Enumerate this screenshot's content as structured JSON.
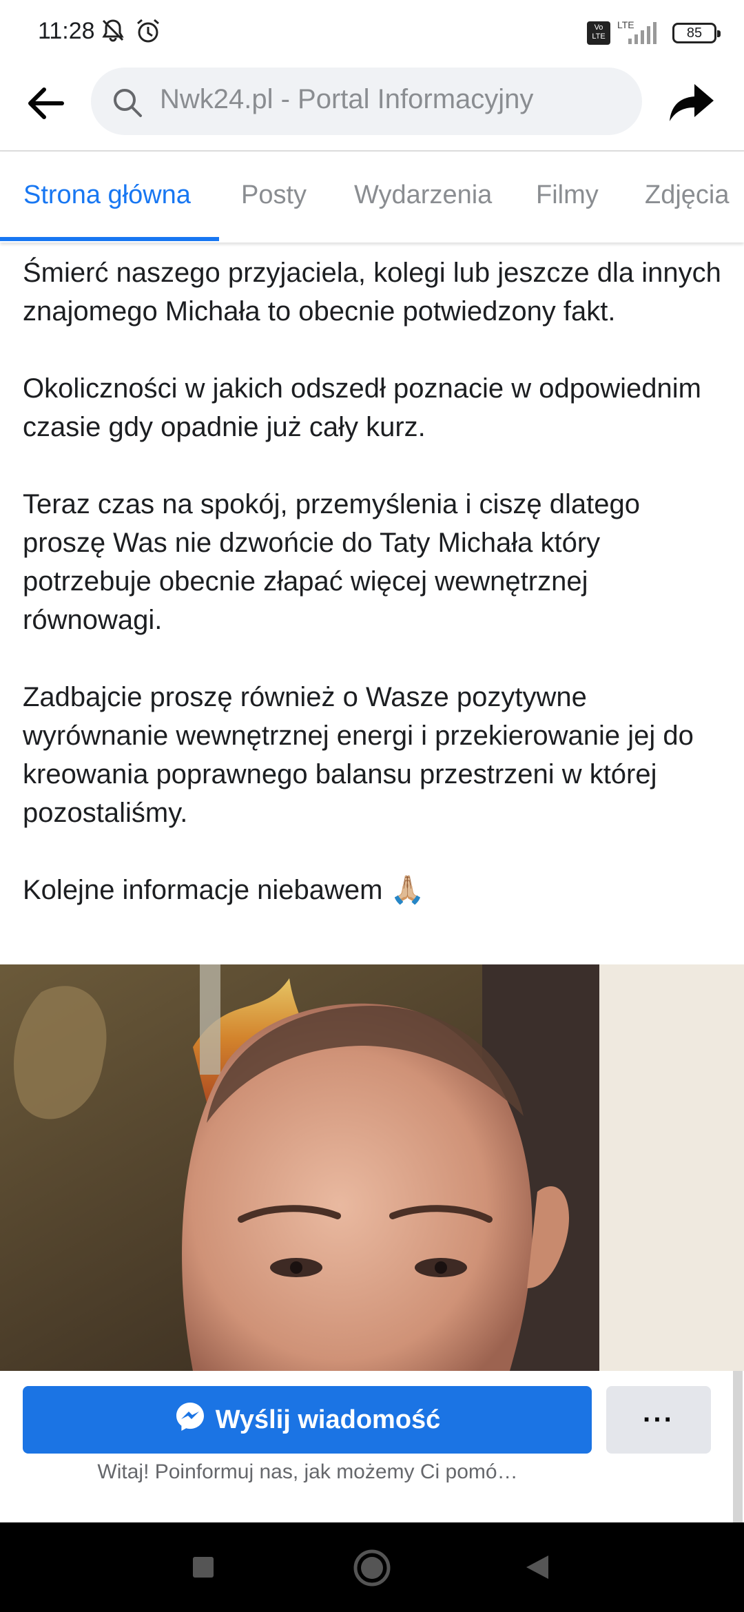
{
  "status_bar": {
    "time": "11:28",
    "icons": [
      "bell-off-icon",
      "alarm-icon",
      "volte-icon",
      "signal-icon"
    ],
    "volte_label": "Vo LTE",
    "network_label": "LTE",
    "battery": "85"
  },
  "top_nav": {
    "search_text": "Nwk24.pl - Portal Informacyjny",
    "back_icon": "back-arrow-icon",
    "share_icon": "share-icon"
  },
  "tabs": [
    {
      "label": "Strona główna",
      "active": true
    },
    {
      "label": "Posty",
      "active": false
    },
    {
      "label": "Wydarzenia",
      "active": false
    },
    {
      "label": "Filmy",
      "active": false
    },
    {
      "label": "Zdjęcia",
      "active": false
    }
  ],
  "post": {
    "paragraphs": [
      "Śmierć naszego przyjaciela, kolegi lub jeszcze dla innych znajomego Michała to obecnie potwiedzony fakt.",
      "Okoliczności w jakich odszedł poznacie w odpowiednim czasie gdy opadnie już cały kurz.",
      "Teraz czas na spokój, przemyślenia i ciszę dlatego proszę Was nie dzwońcie do Taty Michała który potrzebuje obecnie złapać więcej wewnętrznej równowagi.",
      "Zadbajcie proszę również o Wasze pozytywne wyrównanie wewnętrznej energi i przekierowanie jej do kreowania poprawnego balansu przestrzeni w której pozostaliśmy."
    ],
    "closing": "Kolejne informacje niebawem 🙏🏼"
  },
  "actions": {
    "message_button": "Wyślij wiadomość",
    "more_button": "···",
    "greeting": "Witaj! Poinformuj nas, jak możemy Ci pomó…"
  },
  "colors": {
    "accent": "#1877f2",
    "button": "#1b74e4",
    "tab_inactive": "#8a8d91"
  }
}
